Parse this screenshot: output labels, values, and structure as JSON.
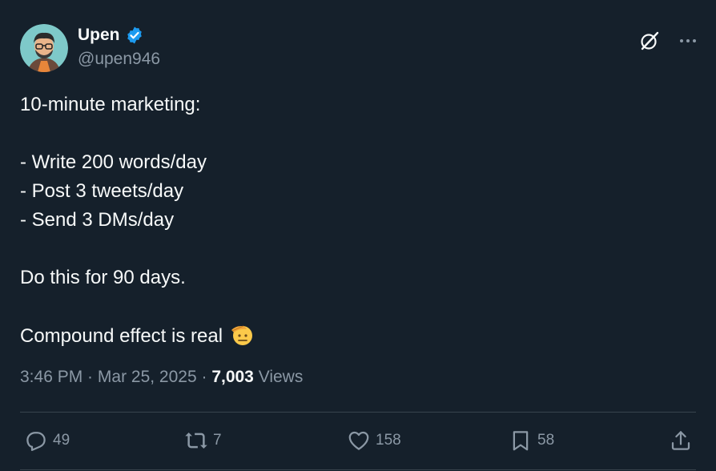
{
  "author": {
    "display_name": "Upen",
    "handle": "@upen946",
    "verified": true
  },
  "tweet": {
    "lines": [
      "10-minute marketing:",
      "",
      "- Write 200 words/day",
      "- Post 3 tweets/day",
      "- Send 3 DMs/day",
      "",
      "Do this for 90 days.",
      "",
      "Compound effect is real"
    ],
    "emoji": "saluting-face"
  },
  "meta": {
    "time": "3:46 PM",
    "separator": " · ",
    "date": "Mar 25, 2025",
    "views_count": "7,003",
    "views_label": " Views"
  },
  "actions": {
    "replies": "49",
    "reposts": "7",
    "likes": "158",
    "bookmarks": "58"
  },
  "colors": {
    "background": "#15202b",
    "text": "#f7f9f9",
    "secondary": "#8b98a5",
    "verified": "#1d9bf0",
    "divider": "#38444d"
  }
}
